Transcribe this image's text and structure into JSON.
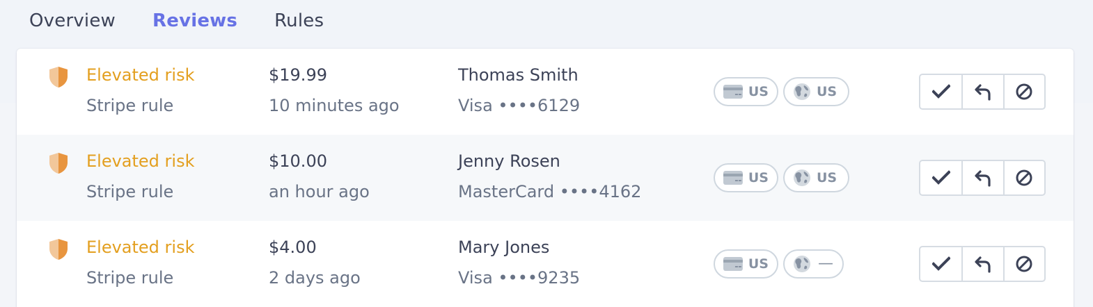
{
  "tabs": [
    {
      "label": "Overview",
      "active": false
    },
    {
      "label": "Reviews",
      "active": true
    },
    {
      "label": "Rules",
      "active": false
    }
  ],
  "colors": {
    "accent": "#6772e5",
    "risk_elevated": "#e39f1f",
    "shield_light": "#f2c79a",
    "shield_dark": "#e8953f",
    "text_primary": "#3c4257",
    "text_secondary": "#697386"
  },
  "reviews": [
    {
      "risk_label": "Elevated risk",
      "rule_label": "Stripe rule",
      "amount": "$19.99",
      "time_ago": "10 minutes ago",
      "customer_name": "Thomas Smith",
      "card_info": "Visa ••••6129",
      "card_country": "US",
      "ip_country": "US",
      "risk_icon": "shield-icon"
    },
    {
      "risk_label": "Elevated risk",
      "rule_label": "Stripe rule",
      "amount": "$10.00",
      "time_ago": "an hour ago",
      "customer_name": "Jenny Rosen",
      "card_info": "MasterCard ••••4162",
      "card_country": "US",
      "ip_country": "US",
      "risk_icon": "shield-icon"
    },
    {
      "risk_label": "Elevated risk",
      "rule_label": "Stripe rule",
      "amount": "$4.00",
      "time_ago": "2 days ago",
      "customer_name": "Mary Jones",
      "card_info": "Visa ••••9235",
      "card_country": "US",
      "ip_country": "—",
      "risk_icon": "shield-icon"
    }
  ],
  "action_icons": [
    "checkmark-icon",
    "refund-icon",
    "block-icon"
  ]
}
